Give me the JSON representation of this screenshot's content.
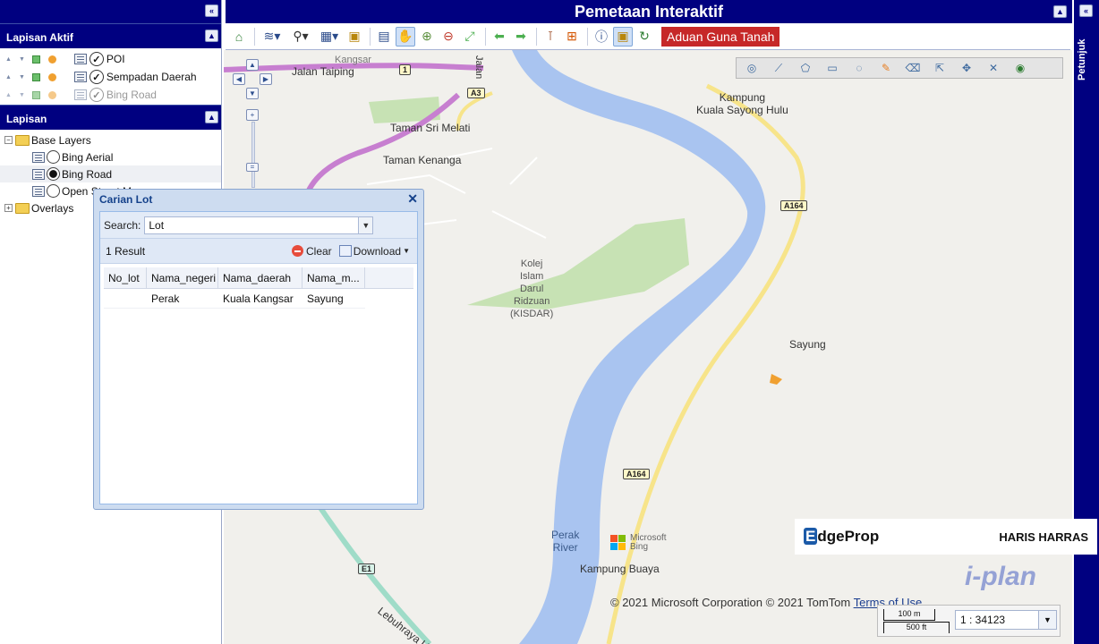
{
  "header": {
    "title": "Pemetaan Interaktif"
  },
  "toolbar": {
    "report_button": "Aduan Guna Tanah"
  },
  "right_panel": {
    "label": "Petunjuk"
  },
  "active_layers": {
    "title": "Lapisan Aktif",
    "items": [
      {
        "label": "POI",
        "checked": true
      },
      {
        "label": "Sempadan Daerah",
        "checked": true
      },
      {
        "label": "Bing Road",
        "checked": true
      }
    ]
  },
  "layers": {
    "title": "Lapisan",
    "base_folder": "Base Layers",
    "base_items": [
      {
        "label": "Bing Aerial",
        "selected": false
      },
      {
        "label": "Bing Road",
        "selected": true
      },
      {
        "label": "Open Street Map",
        "selected": false
      }
    ],
    "overlays_folder": "Overlays"
  },
  "dialog": {
    "title": "Carian Lot",
    "search_label": "Search:",
    "search_value": "Lot",
    "result_count": "1 Result",
    "clear_label": "Clear",
    "download_label": "Download",
    "columns": [
      "No_lot",
      "Nama_negeri",
      "Nama_daerah",
      "Nama_m..."
    ],
    "rows": [
      {
        "no_lot": "",
        "negeri": "Perak",
        "daerah": "Kuala Kangsar",
        "mukim": "Sayung"
      }
    ]
  },
  "map": {
    "labels": {
      "kangsar": "Kangsar",
      "jalan_taiping": "Jalan Taiping",
      "jalan": "Jalan",
      "taman_sri_melati": "Taman Sri Melati",
      "taman_kenanga": "Taman Kenanga",
      "kampung_kuala_1": "Kampung",
      "kampung_kuala_2": "Kuala Sayong Hulu",
      "kolej": "Kolej\nIslam\nDarul\nRidzuan\n(KISDAR)",
      "sayung": "Sayung",
      "perak_river": "Perak\nRiver",
      "kampung_buaya": "Kampung Buaya",
      "lebuhraya": "Lebuhraya Utara S",
      "microsoft_bing": "Microsoft\nBing"
    },
    "routes": {
      "r1": "1",
      "a3": "A3",
      "a164_top": "A164",
      "a164_bottom": "A164",
      "e1": "E1"
    },
    "copyright": "© 2021 Microsoft Corporation © 2021 TomTom",
    "terms": "Terms of Use",
    "scale_top": "100 m",
    "scale_bottom": "500 ft",
    "scale_value": "1 : 34123"
  },
  "branding": {
    "edgeprop": "dgeProp",
    "edgeprop_e": "E",
    "author": "HARIS HARRAS",
    "iplan": "i-plan"
  },
  "colors": {
    "navy": "#000080",
    "report_red": "#c62828",
    "river": "#a9c4f0",
    "green": "#c7e2b4",
    "highway_pink": "#c77fd0",
    "road_yellow": "#f7e48a"
  }
}
